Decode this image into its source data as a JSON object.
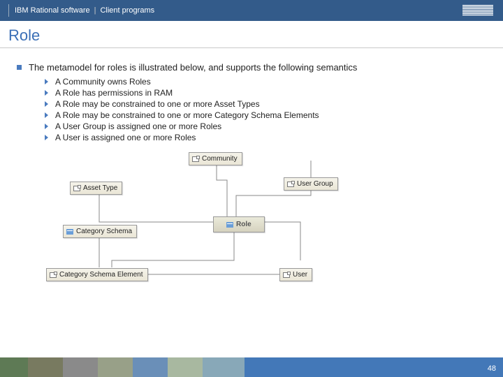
{
  "header": {
    "text1": "IBM Rational software",
    "separator": "|",
    "text2": "Client programs",
    "logo_alt": "IBM"
  },
  "title": "Role",
  "main_point": "The metamodel for roles is illustrated below, and supports the following semantics",
  "sub_points": [
    "A Community owns Roles",
    "A Role has permissions in RAM",
    "A Role may be constrained to one or more Asset Types",
    "A Role may be constrained to one or more Category Schema Elements",
    "A User Group is assigned one or more Roles",
    "A User is assigned one or more Roles"
  ],
  "diagram": {
    "community": "Community",
    "asset_type": "Asset Type",
    "user_group": "User Group",
    "category_schema": "Category Schema",
    "role": "Role",
    "category_schema_element": "Category Schema Element",
    "user": "User"
  },
  "page_number": "48"
}
